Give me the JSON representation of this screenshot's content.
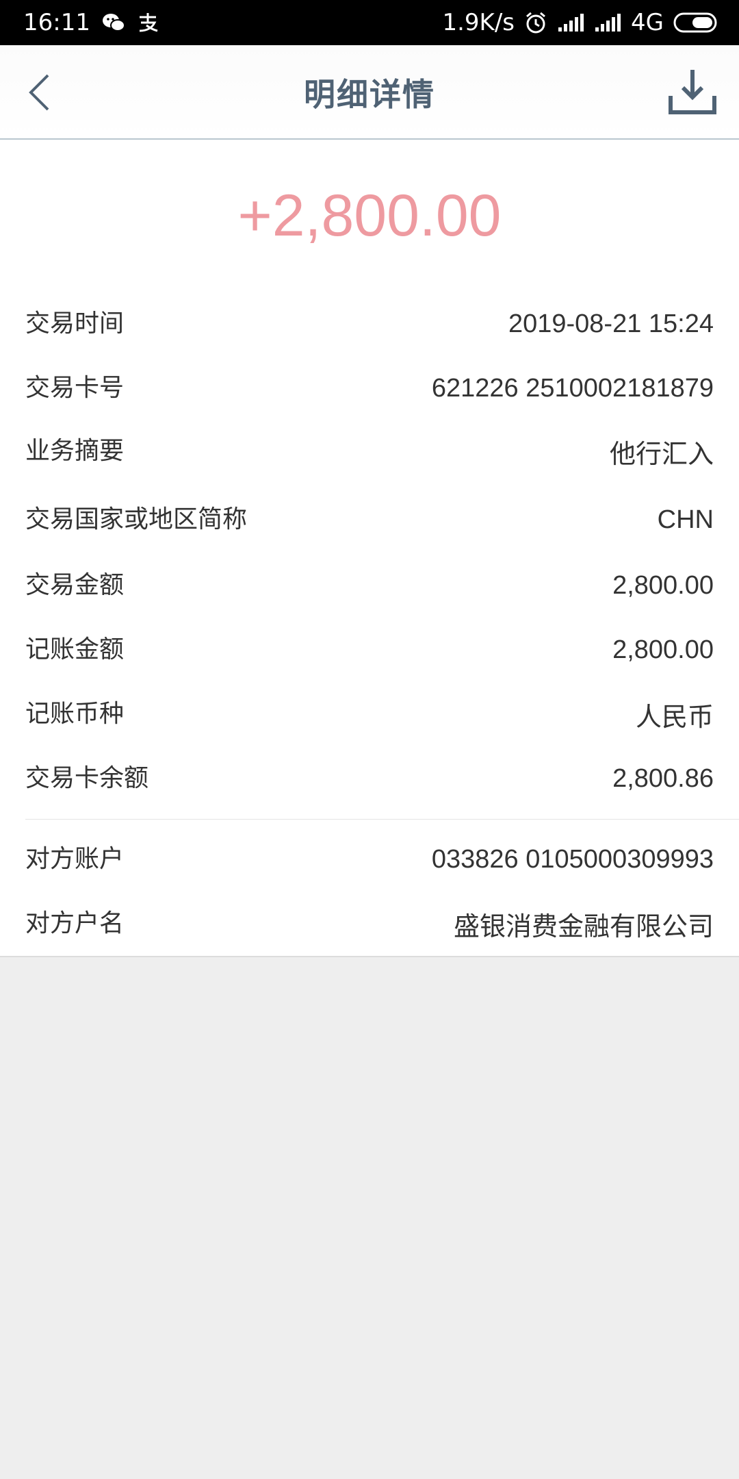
{
  "status_bar": {
    "time": "16:11",
    "speed": "1.9K/s",
    "network": "4G",
    "left_icons": [
      "wechat-icon",
      "alipay-icon"
    ],
    "right_icons": [
      "alarm-icon",
      "signal-icon",
      "signal-icon",
      "battery-icon"
    ]
  },
  "header": {
    "title": "明细详情",
    "back_icon": "chevron-left-icon",
    "download_icon": "download-icon",
    "accent_color": "#4f6274"
  },
  "transaction": {
    "amount": "+2,800.00",
    "amount_color": "#ee9aa0",
    "details": [
      {
        "label": "交易时间",
        "value": "2019-08-21 15:24"
      },
      {
        "label": "交易卡号",
        "value": "621226 2510002181879"
      },
      {
        "label": "业务摘要",
        "value": "他行汇入"
      },
      {
        "label": "交易国家或地区简称",
        "value": "CHN"
      },
      {
        "label": "交易金额",
        "value": "2,800.00"
      },
      {
        "label": "记账金额",
        "value": "2,800.00"
      },
      {
        "label": "记账币种",
        "value": "人民币"
      },
      {
        "label": "交易卡余额",
        "value": "2,800.86"
      }
    ],
    "counterparty": [
      {
        "label": "对方账户",
        "value": "033826 0105000309993"
      },
      {
        "label": "对方户名",
        "value": "盛银消费金融有限公司"
      }
    ]
  }
}
